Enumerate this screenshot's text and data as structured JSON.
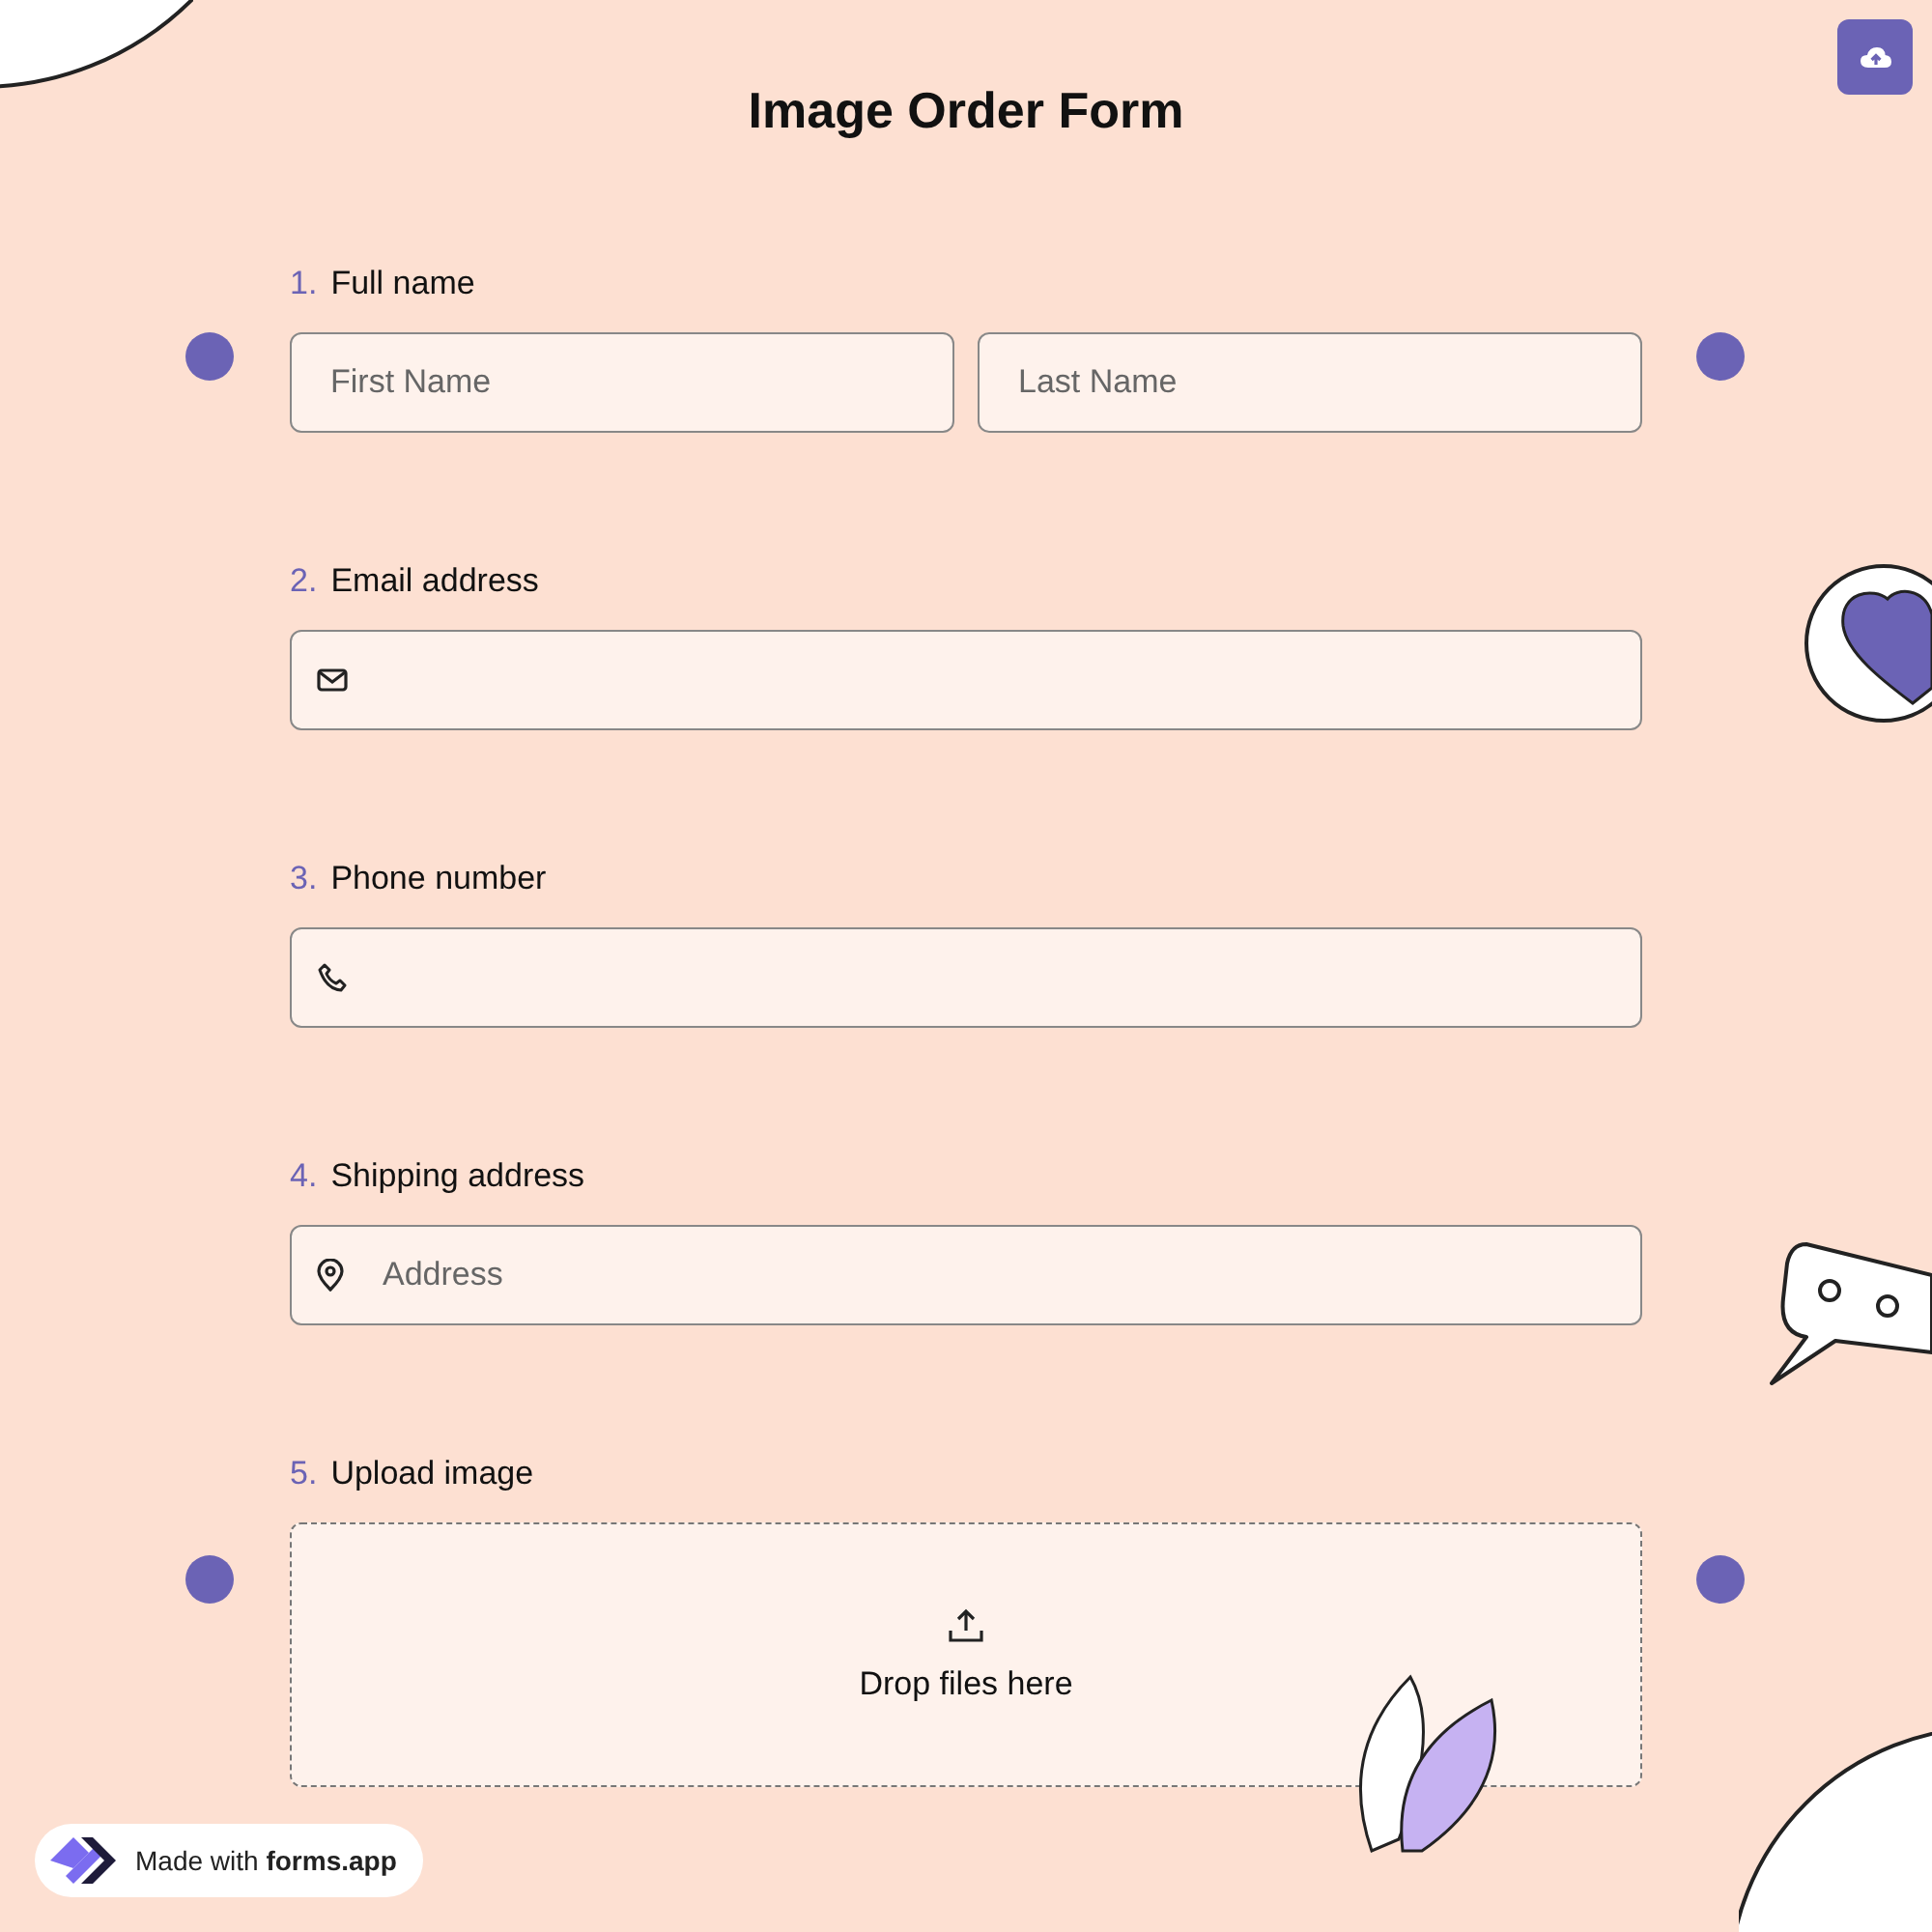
{
  "title": "Image Order Form",
  "questions": [
    {
      "kind": "name",
      "number": "1.",
      "label": "Full name",
      "fields": [
        {
          "placeholder": "First Name"
        },
        {
          "placeholder": "Last Name"
        }
      ]
    },
    {
      "kind": "email",
      "number": "2.",
      "label": "Email address"
    },
    {
      "kind": "phone",
      "number": "3.",
      "label": "Phone number"
    },
    {
      "kind": "address",
      "number": "4.",
      "label": "Shipping address",
      "fields": [
        {
          "placeholder": "Address"
        }
      ]
    },
    {
      "kind": "upload",
      "number": "5.",
      "label": "Upload image",
      "drop_text": "Drop files here"
    }
  ],
  "badge": "Made with **forms.app**"
}
